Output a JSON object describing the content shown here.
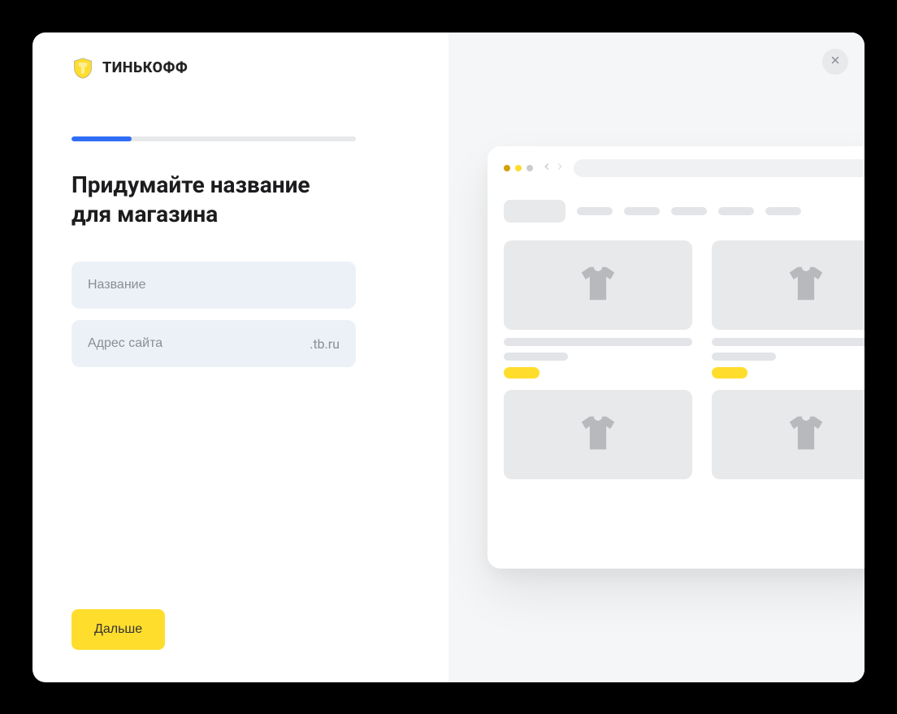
{
  "brand": {
    "name": "ТИНЬКОФФ"
  },
  "progress": {
    "percent": 21
  },
  "heading_line1": "Придумайте название",
  "heading_line2": "для магазина",
  "fields": {
    "name_placeholder": "Название",
    "site_placeholder": "Адрес сайта",
    "site_suffix": ".tb.ru"
  },
  "buttons": {
    "next": "Дальше"
  }
}
